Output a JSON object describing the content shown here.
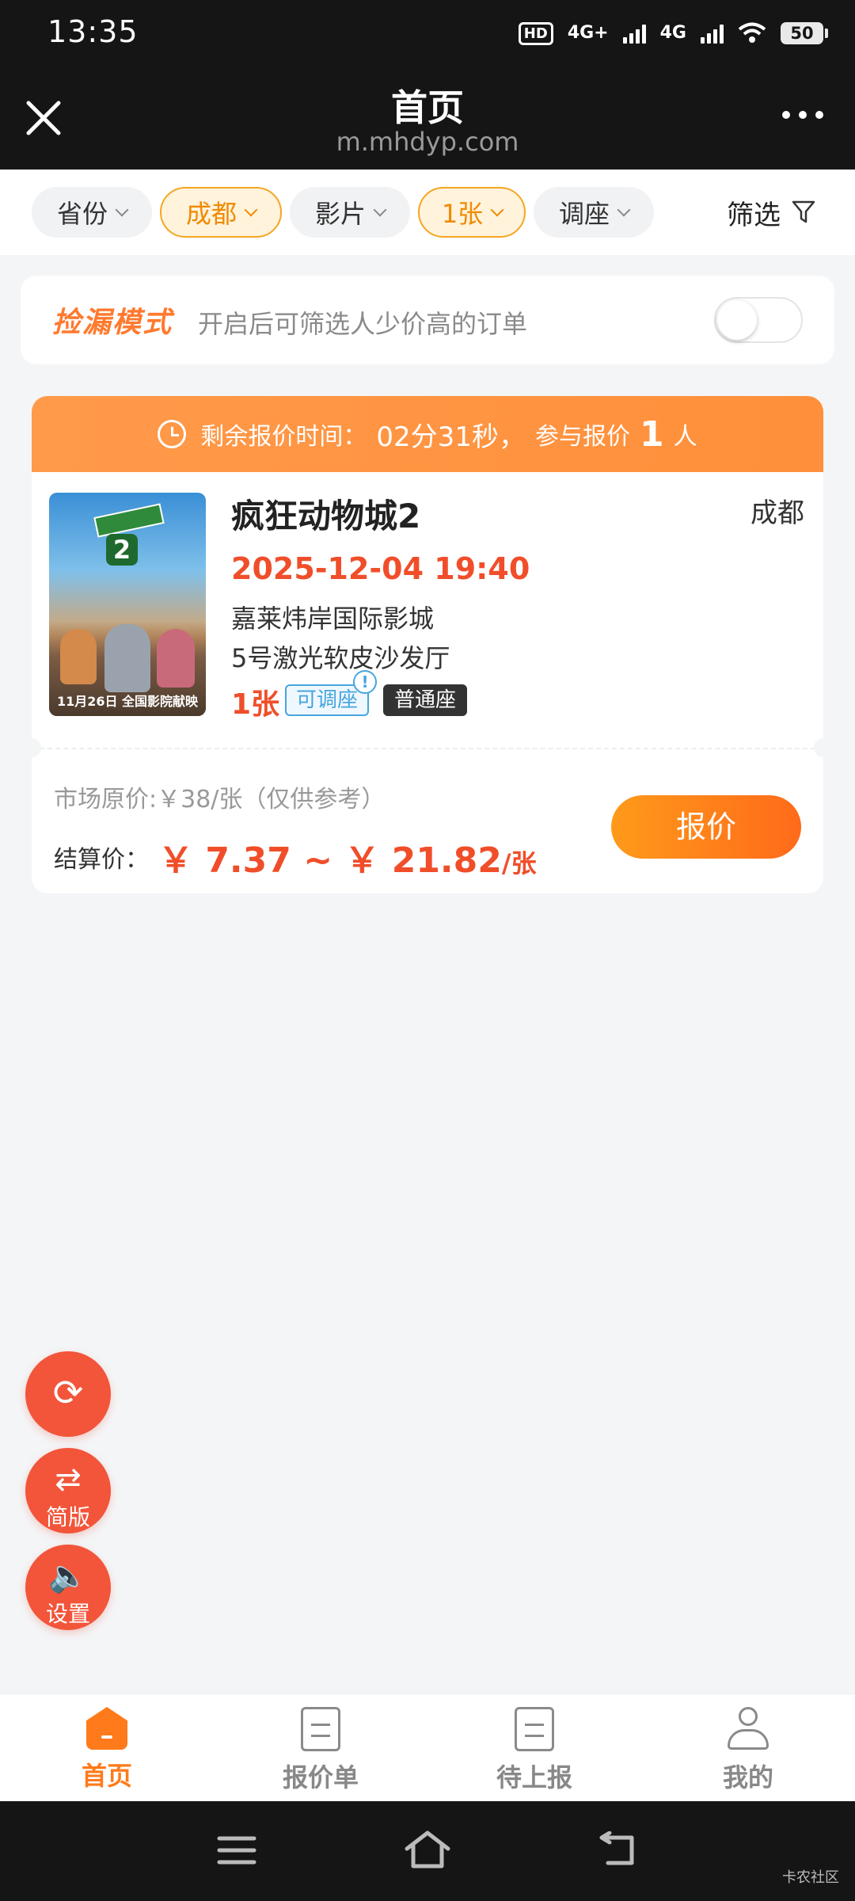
{
  "status_bar": {
    "time": "13:35",
    "hd": "HD",
    "net1": "4G+",
    "net2": "4G",
    "battery": "50"
  },
  "title_bar": {
    "title": "首页",
    "url": "m.mhdyp.com"
  },
  "filters": {
    "chips": [
      {
        "label": "省份",
        "active": false
      },
      {
        "label": "成都",
        "active": true
      },
      {
        "label": "影片",
        "active": false
      },
      {
        "label": "1张",
        "active": true
      },
      {
        "label": "调座",
        "active": false
      }
    ],
    "filter_label": "筛选"
  },
  "pick_mode": {
    "title": "捡漏模式",
    "desc": "开启后可筛选人少价高的订单",
    "enabled": false
  },
  "order": {
    "header_label": "剩余报价时间：",
    "header_time": "02分31秒，",
    "header_participants_prefix": "参与报价",
    "header_count": "1",
    "header_participants_suffix": "人",
    "movie_title": "疯狂动物城2",
    "city": "成都",
    "datetime": "2025-12-04 19:40",
    "cinema": "嘉莱炜岸国际影城",
    "hall": "5号激光软皮沙发厅",
    "tickets": "1张",
    "tag_adjust": "可调座",
    "tag_info": "!",
    "tag_normal": "普通座",
    "poster_num": "2",
    "poster_date": "11月26日 全国影院献映",
    "market_price": "市场原价:￥38/张（仅供参考）",
    "settle_label": "结算价：",
    "settle_price": "￥ 7.37 ~ ￥ 21.82",
    "settle_unit": "/张",
    "quote_button": "报价"
  },
  "fabs": {
    "refresh_icon": "⟳",
    "simple_icon": "⇄",
    "simple_label": "简版",
    "settings_icon": "🔈",
    "settings_label": "设置"
  },
  "bottom_nav": [
    {
      "label": "首页",
      "icon": "home-icon",
      "active": true
    },
    {
      "label": "报价单",
      "icon": "document-icon",
      "active": false
    },
    {
      "label": "待上报",
      "icon": "document-icon",
      "active": false
    },
    {
      "label": "我的",
      "icon": "person-icon",
      "active": false
    }
  ],
  "watermark": "卡农社区",
  "colors": {
    "accent": "#ff7a1a",
    "price": "#f04e2a",
    "fab": "#f2553a",
    "header_bg": "#151515",
    "tag_blue": "#46a6e0"
  }
}
